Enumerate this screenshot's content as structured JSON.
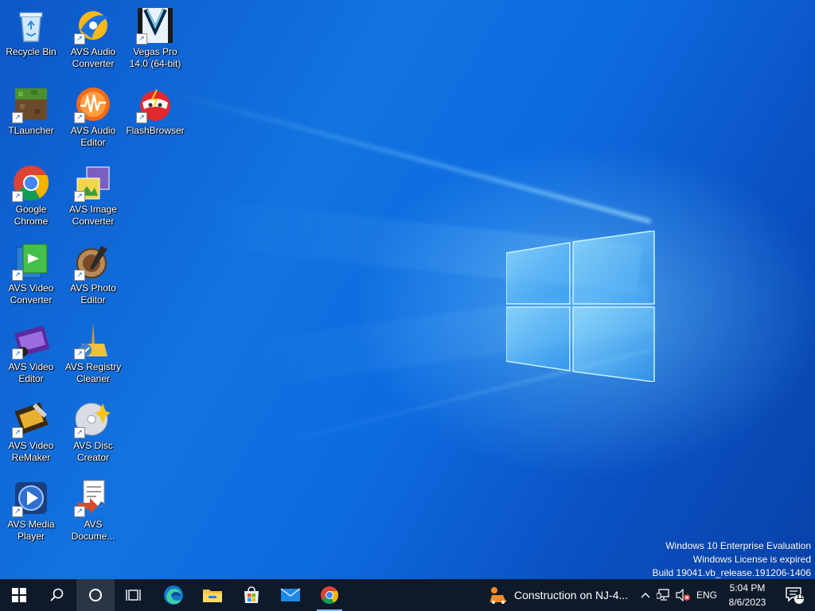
{
  "desktop": {
    "icons": [
      {
        "label": "Recycle Bin",
        "icon": "recycle-bin-icon"
      },
      {
        "label": "AVS Audio\nConverter",
        "icon": "avs-audio-converter-icon"
      },
      {
        "label": "Vegas Pro\n14.0 (64-bit)",
        "icon": "vegas-pro-icon"
      },
      {
        "label": "TLauncher",
        "icon": "tlauncher-icon"
      },
      {
        "label": "AVS Audio\nEditor",
        "icon": "avs-audio-editor-icon"
      },
      {
        "label": "FlashBrowser",
        "icon": "flashbrowser-icon"
      },
      {
        "label": "Google\nChrome",
        "icon": "google-chrome-icon"
      },
      {
        "label": "AVS Image\nConverter",
        "icon": "avs-image-converter-icon"
      },
      {
        "label": "AVS Video\nConverter",
        "icon": "avs-video-converter-icon"
      },
      {
        "label": "AVS Photo\nEditor",
        "icon": "avs-photo-editor-icon"
      },
      {
        "label": "AVS Video\nEditor",
        "icon": "avs-video-editor-icon"
      },
      {
        "label": "AVS Registry\nCleaner",
        "icon": "avs-registry-cleaner-icon"
      },
      {
        "label": "AVS Video\nReMaker",
        "icon": "avs-video-remaker-icon"
      },
      {
        "label": "AVS Disc\nCreator",
        "icon": "avs-disc-creator-icon"
      },
      {
        "label": "AVS Media\nPlayer",
        "icon": "avs-media-player-icon"
      },
      {
        "label": "AVS\nDocume...",
        "icon": "avs-document-converter-icon"
      }
    ]
  },
  "watermark": {
    "line1": "Windows 10 Enterprise Evaluation",
    "line2": "Windows License is expired",
    "line3": "Build 19041.vb_release.191206-1406"
  },
  "taskbar": {
    "pinned": [
      {
        "icon": "start-windows-icon"
      },
      {
        "icon": "search-icon"
      },
      {
        "icon": "cortana-circle-icon"
      },
      {
        "icon": "task-view-icon"
      },
      {
        "icon": "edge-icon"
      },
      {
        "icon": "file-explorer-icon"
      },
      {
        "icon": "microsoft-store-icon"
      },
      {
        "icon": "mail-icon"
      },
      {
        "icon": "chrome-icon"
      }
    ],
    "notification": "Construction on NJ-4...",
    "language": "ENG",
    "time": "5:04 PM",
    "date": "8/6/2023",
    "notification_count": "11"
  },
  "colors": {
    "taskbar_bg": "#0e1a2a",
    "desktop_blue": "#1273e0",
    "accent": "#7fb6f0"
  }
}
